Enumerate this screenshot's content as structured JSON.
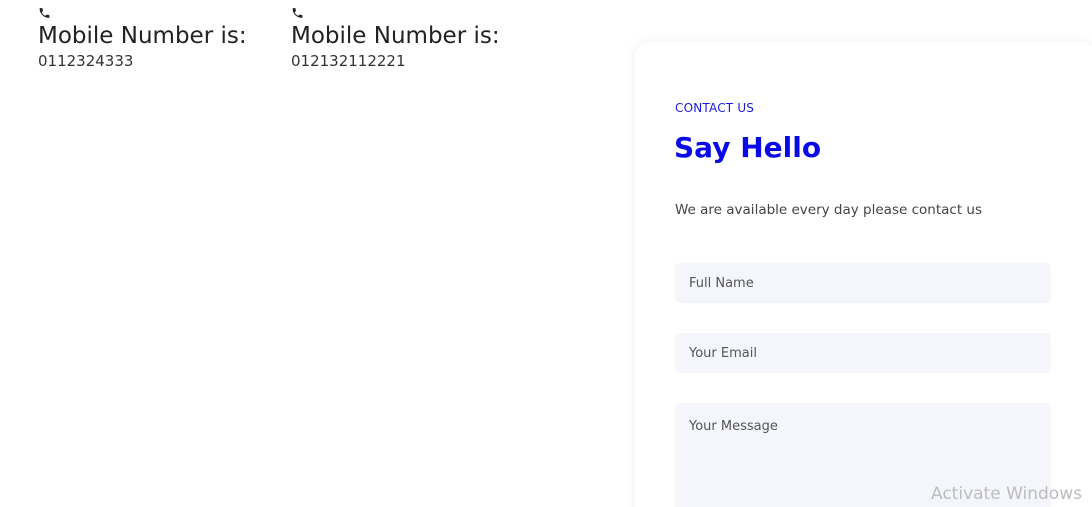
{
  "phones": [
    {
      "icon": "phone-icon",
      "title": "Mobile Number is:",
      "number": "0112324333"
    },
    {
      "icon": "phone-icon",
      "title": "Mobile Number is:",
      "number": "012132112221"
    }
  ],
  "contact": {
    "eyebrow": "CONTACT US",
    "heading": "Say Hello",
    "subtitle": "We are available every day please contact us",
    "fields": {
      "name_placeholder": "Full Name",
      "email_placeholder": "Your Email",
      "message_placeholder": "Your Message"
    },
    "accent_color": "#0a0ae8",
    "field_bg": "#f4f6fb"
  },
  "watermark": "Activate Windows"
}
